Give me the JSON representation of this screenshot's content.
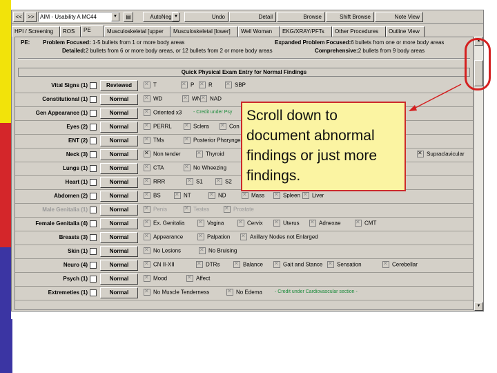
{
  "toolbar": {
    "nav_back": "<<",
    "nav_forward": ">>",
    "template_value": "AIM - Usability A MC44",
    "autoneg": "AutoNeg",
    "undo": "Undo",
    "detail": "Detail",
    "browse": "Browse",
    "shift_browse": "Shift Browse",
    "note_view": "Note View"
  },
  "tabs": [
    "HPI / Screening",
    "ROS",
    "PE",
    "Musculoskeletal [upper",
    "Musculoskeletal [lower]",
    "Well Woman",
    "EKG/XRAY/PFTs",
    "Other Procedures",
    "Outline View"
  ],
  "active_tab": "PE",
  "pe_levels": {
    "pe_label": "PE:",
    "problem_focused_label": "Problem Focused:",
    "problem_focused_text": "1-5 bullets from 1 or more body areas",
    "detailed_label": "Detailed:",
    "detailed_text": "2 bullets from 6 or more body areas, or 12 bullets from 2 or more body areas",
    "expanded_label": "Expanded Problem Focused:",
    "expanded_text": "6 bullets from one or more body areas",
    "comprehensive_label": "Comprehensive:",
    "comprehensive_text": "2 bullets from 9 body areas"
  },
  "quick_header": "Quick Physical Exam Entry for Normal Findings",
  "rows": [
    {
      "label": "Vital Signs (1)",
      "button": "Reviewed",
      "findings": [
        "T",
        "P",
        "R",
        "SBP"
      ]
    },
    {
      "label": "Constitutional (1)",
      "button": "Normal",
      "findings": [
        "WD",
        "WN",
        "NAD"
      ]
    },
    {
      "label": "Gen Appearance (1)",
      "button": "Normal",
      "findings": [
        "Oriented x3"
      ],
      "note": "- Credit under Psy"
    },
    {
      "label": "Eyes (2)",
      "button": "Normal",
      "findings": [
        "PERRL",
        "Sclera",
        "Con"
      ]
    },
    {
      "label": "ENT (2)",
      "button": "Normal",
      "findings": [
        "TMs",
        "Posterior Pharyngeal"
      ]
    },
    {
      "label": "Neck (3)",
      "button": "Normal",
      "findings": [
        "Non tender",
        "Thyroid"
      ],
      "extra_finding": "Supraclavicular"
    },
    {
      "label": "Lungs (1)",
      "button": "Normal",
      "findings": [
        "CTA",
        "No Wheezing"
      ]
    },
    {
      "label": "Heart (1)",
      "button": "Normal",
      "findings": [
        "RRR",
        "S1",
        "S2"
      ]
    },
    {
      "label": "Abdomen (2)",
      "button": "Normal",
      "findings": [
        "BS",
        "NT",
        "ND",
        "Mass",
        "Spleen",
        "Liver"
      ]
    },
    {
      "label": "Male Genitalia (1)",
      "button": "Normal",
      "findings": [
        "Penis",
        "Testes",
        "Prostate"
      ],
      "disabled": true
    },
    {
      "label": "Female Genitalia (4)",
      "button": "Normal",
      "findings": [
        "Ex. Genitalia",
        "Vagina",
        "Cervix",
        "Uterus",
        "Adnexae",
        "CMT"
      ]
    },
    {
      "label": "Breasts (3)",
      "button": "Normal",
      "findings": [
        "Appearance",
        "Palpation",
        "Axillary Nodes not Enlarged"
      ]
    },
    {
      "label": "Skin (1)",
      "button": "Normal",
      "findings": [
        "No Lesions",
        "No Bruising"
      ]
    },
    {
      "label": "Neuro (4)",
      "button": "Normal",
      "findings": [
        "CN II-XII",
        "DTRs",
        "Balance",
        "Gait and Stance",
        "Sensation",
        "Cerebellar"
      ]
    },
    {
      "label": "Psych (1)",
      "button": "Normal",
      "findings": [
        "Mood",
        "Affect"
      ]
    },
    {
      "label": "Extremeties (1)",
      "button": "Normal",
      "findings": [
        "No Muscle Tenderness",
        "No Edema"
      ],
      "note": "- Credit under Cardiovascular section -"
    }
  ],
  "callout": {
    "text": "Scroll down to document abnormal findings or just more findings."
  },
  "colors": {
    "window_gray": "#d4d0c8",
    "callout_fill": "#fbf4a2",
    "callout_border": "#cc2a2a",
    "note_green": "#1a8a3a",
    "highlight_red": "#d42020"
  }
}
